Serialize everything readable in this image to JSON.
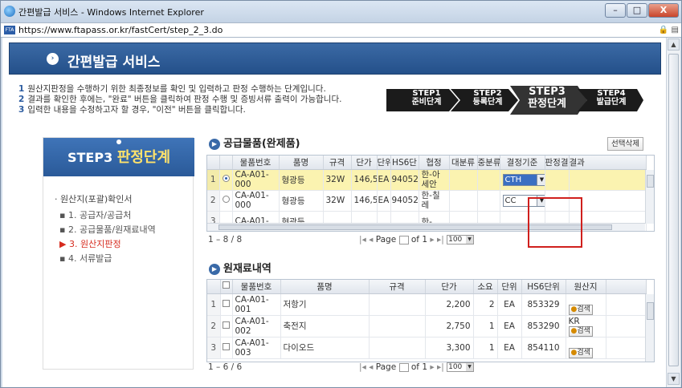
{
  "window": {
    "title": "간편발급 서비스 - Windows Internet Explorer",
    "url": "https://www.ftapass.or.kr/fastCert/step_2_3.do",
    "favicon_text": "FTA",
    "minimize": "–",
    "maximize": "□",
    "close": "X"
  },
  "header": {
    "title": "간편발급 서비스",
    "bullet": "›"
  },
  "instructions": [
    {
      "num": "1",
      "text": "원산지판정을 수행하기 위한 최종정보를 확인 및 입력하고 판정 수행하는 단계입니다."
    },
    {
      "num": "2",
      "text": "결과를 확인한 후에는, \"완료\" 버튼을 클릭하여 판정 수행 및 증빙서류 출력이 가능합니다."
    },
    {
      "num": "3",
      "text": "입력한 내용을 수정하고자 할 경우, \"이전\" 버튼을 클릭합니다."
    }
  ],
  "steps": [
    {
      "line1": "STEP1",
      "line2": "준비단계"
    },
    {
      "line1": "STEP2",
      "line2": "등록단계"
    },
    {
      "line1": "STEP3",
      "line2": "판정단계"
    },
    {
      "line1": "STEP4",
      "line2": "발급단계"
    }
  ],
  "sidebar": {
    "banner_prefix": "STEP3",
    "banner_title": "판정단계",
    "section": "원산지(포괄)확인서",
    "items": [
      {
        "label": "1. 공급자/공급처"
      },
      {
        "label": "2. 공급물품/원재료내역"
      },
      {
        "label": "3. 원산지판정"
      },
      {
        "label": "4. 서류발급"
      }
    ]
  },
  "products": {
    "title": "공급물품(완제품)",
    "delete_button": "선택삭제",
    "columns": [
      "",
      "",
      "물품번호",
      "품명",
      "규격",
      "단가",
      "단위",
      "HS6단",
      "협정",
      "대분류",
      "중분류",
      "결정기준",
      "판정결",
      "결과"
    ],
    "rows": [
      {
        "num": "1",
        "code": "CA-A01-000",
        "name": "형광등",
        "spec": "32W",
        "price": "146,5",
        "unit": "EA",
        "hs": "94052",
        "agreement": "한-아세안",
        "criterion": "CTH"
      },
      {
        "num": "2",
        "code": "CA-A01-000",
        "name": "형광등",
        "spec": "32W",
        "price": "146,5",
        "unit": "EA",
        "hs": "94052",
        "agreement": "한-칠레",
        "criterion": "CC"
      },
      {
        "num": "3",
        "code": "CA-A01-",
        "name": "형광등",
        "spec": "",
        "price": "",
        "unit": "",
        "hs": "",
        "agreement": "한-",
        "criterion": ""
      }
    ],
    "pager": {
      "range": "1 – 8 / 8",
      "page_label": "Page",
      "page_value": "1",
      "of_label": "of 1",
      "size": "100"
    }
  },
  "materials": {
    "title": "원재료내역",
    "columns": [
      "",
      "",
      "물품번호",
      "품명",
      "규격",
      "단가",
      "소요",
      "단위",
      "HS6단위",
      "원산지"
    ],
    "rows": [
      {
        "num": "1",
        "code": "CA-A01-001",
        "name": "저항기",
        "spec": "",
        "price": "2,200",
        "qty": "2",
        "unit": "EA",
        "hs": "853329",
        "origin": "",
        "search": "검색"
      },
      {
        "num": "2",
        "code": "CA-A01-002",
        "name": "축전지",
        "spec": "",
        "price": "2,750",
        "qty": "1",
        "unit": "EA",
        "hs": "853290",
        "origin": "KR",
        "search": "검색"
      },
      {
        "num": "3",
        "code": "CA-A01-003",
        "name": "다이오드",
        "spec": "",
        "price": "3,300",
        "qty": "1",
        "unit": "EA",
        "hs": "854110",
        "origin": "",
        "search": "검색"
      }
    ],
    "pager": {
      "range": "1 – 6 / 6",
      "page_label": "Page",
      "page_value": "1",
      "of_label": "of 1",
      "size": "100"
    }
  },
  "colors": {
    "accent": "#2c5ca0",
    "highlight_row": "#fbf3b0",
    "callout": "#d0201d",
    "current_menu": "#d62b1e"
  }
}
